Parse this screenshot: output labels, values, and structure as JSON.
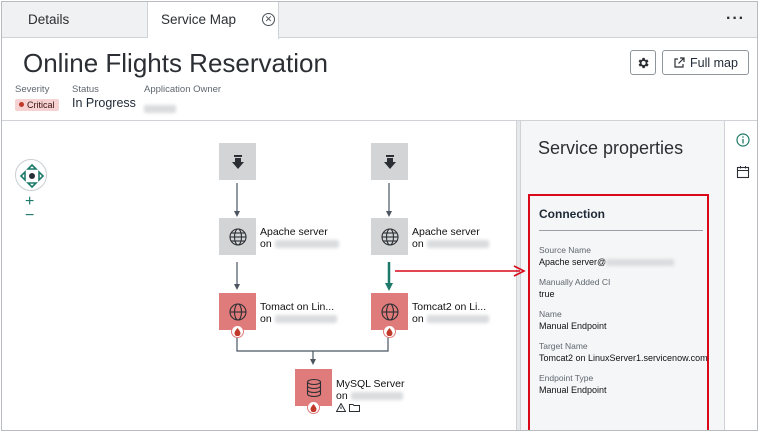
{
  "tabs": [
    {
      "label": "Details"
    },
    {
      "label": "Service Map"
    }
  ],
  "header": {
    "title": "Online Flights Reservation",
    "full_map_label": "Full map",
    "severity_label": "Severity",
    "severity_value": "Critical",
    "status_label": "Status",
    "status_value": "In Progress",
    "owner_label": "Application Owner"
  },
  "map": {
    "nodes": [
      {
        "name": "Apache server",
        "sub": "on"
      },
      {
        "name": "Apache server",
        "sub": "on"
      },
      {
        "name": "Tomact on Lin...",
        "sub": "on"
      },
      {
        "name": "Tomcat2 on Li...",
        "sub": "on"
      },
      {
        "name": "MySQL Server",
        "sub": "on"
      }
    ]
  },
  "panel": {
    "title": "Service properties",
    "connection_heading": "Connection",
    "fields": [
      {
        "label": "Source Name",
        "value": "Apache server@"
      },
      {
        "label": "Manually Added CI",
        "value": "true"
      },
      {
        "label": "Name",
        "value": "Manual Endpoint"
      },
      {
        "label": "Target Name",
        "value": "Tomcat2 on LinuxServer1.servicenow.com"
      },
      {
        "label": "Endpoint Type",
        "value": "Manual Endpoint"
      }
    ]
  },
  "colors": {
    "accent": "#1d7a6a",
    "critical": "#e07b7b",
    "highlight": "#d9091a"
  }
}
